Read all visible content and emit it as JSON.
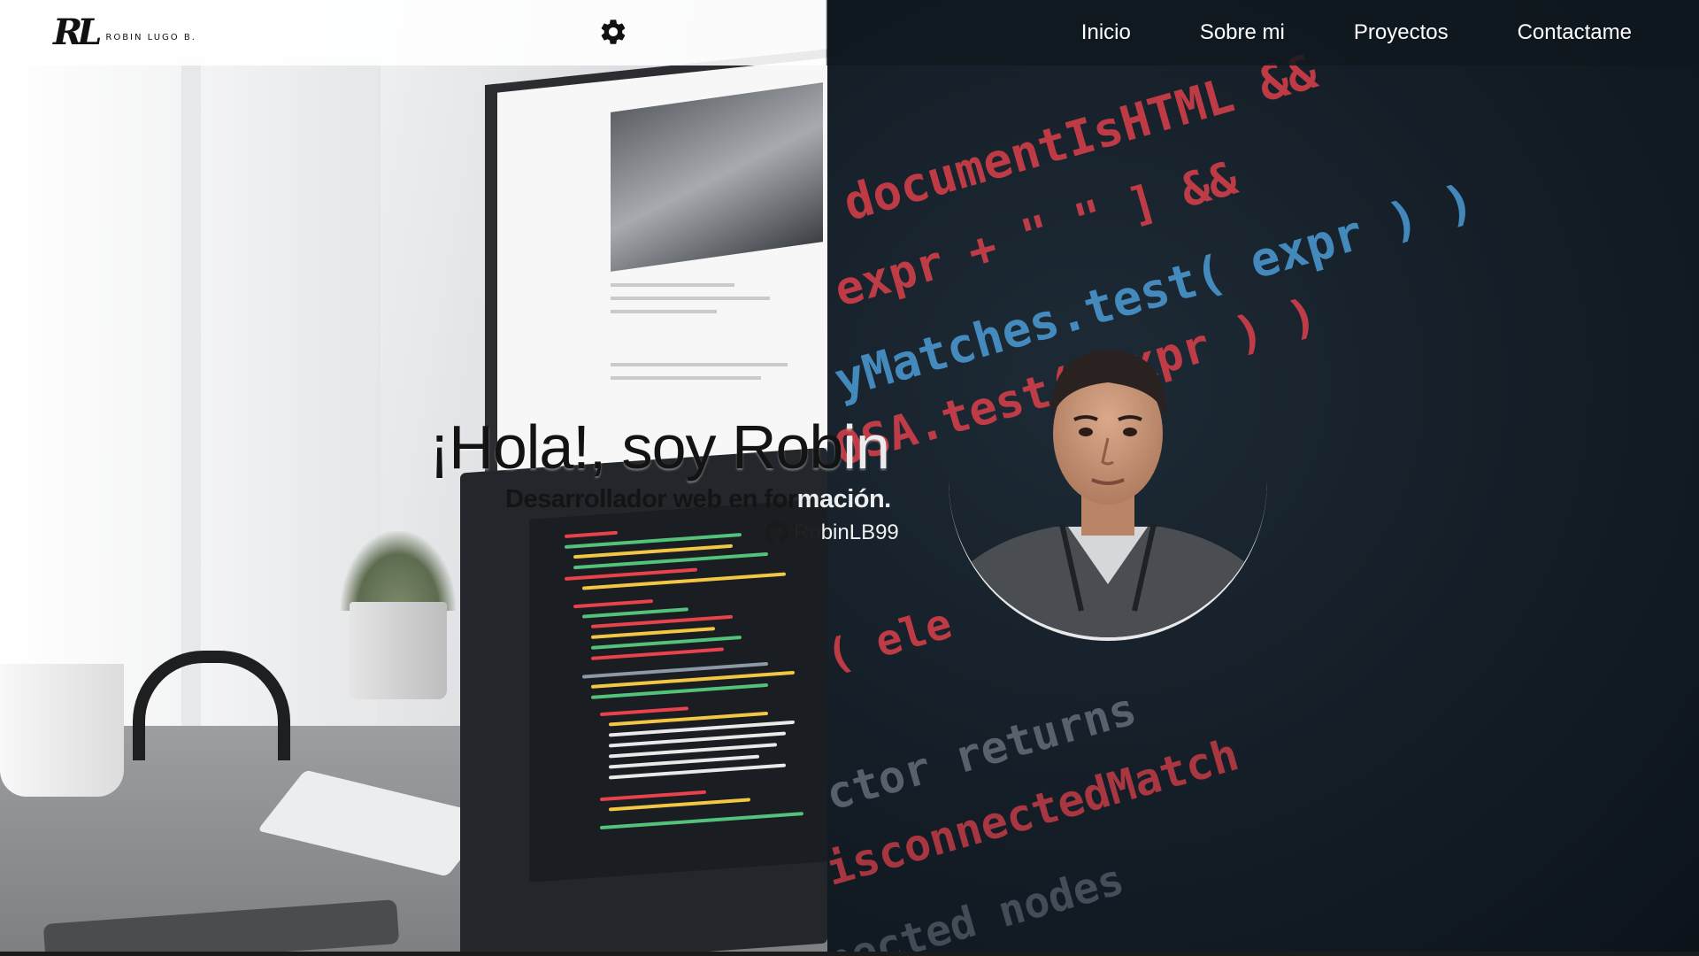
{
  "header": {
    "logo_mark": "RL",
    "logo_name": "ROBIN LUGO B.",
    "theme_toggle_icon": "gear-icon"
  },
  "nav": {
    "items": [
      {
        "label": "Inicio"
      },
      {
        "label": "Sobre mi"
      },
      {
        "label": "Proyectos"
      },
      {
        "label": "Contactame"
      }
    ]
  },
  "hero": {
    "title_left": "¡Hola!, soy Rob",
    "title_right": "in",
    "subtitle_left": "Desarrollador web en for",
    "subtitle_right": "mación.",
    "github_icon": "github-icon",
    "github_left": "Ro",
    "github_right": "binLB99"
  },
  "background_code": [
    "documentIsHTML &&",
    "expr + \" \" ] &&",
    "yMatches.test( expr ) )",
    "OSA.test( expr ) )",
    "( ele",
    "ctor returns",
    "isconnectedMatch",
    "nected nodes"
  ],
  "colors": {
    "dark_bg": "#141d26",
    "light_bg": "#eceef0",
    "nav_text": "#ffffff",
    "code_red": "#e8424d",
    "code_blue": "#4fa3e0",
    "code_yellow": "#f2c744",
    "code_green": "#53c27a"
  }
}
